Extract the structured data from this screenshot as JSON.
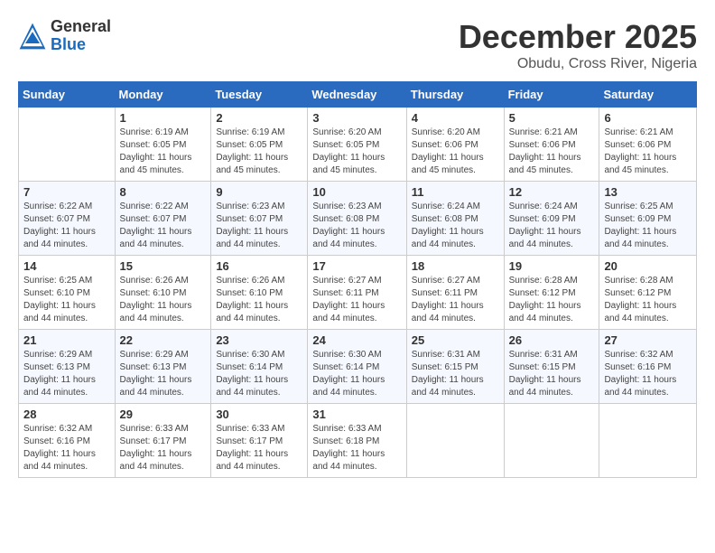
{
  "header": {
    "logo_general": "General",
    "logo_blue": "Blue",
    "month_title": "December 2025",
    "location": "Obudu, Cross River, Nigeria"
  },
  "calendar": {
    "weekdays": [
      "Sunday",
      "Monday",
      "Tuesday",
      "Wednesday",
      "Thursday",
      "Friday",
      "Saturday"
    ],
    "rows": [
      [
        {
          "day": "",
          "info": ""
        },
        {
          "day": "1",
          "info": "Sunrise: 6:19 AM\nSunset: 6:05 PM\nDaylight: 11 hours\nand 45 minutes."
        },
        {
          "day": "2",
          "info": "Sunrise: 6:19 AM\nSunset: 6:05 PM\nDaylight: 11 hours\nand 45 minutes."
        },
        {
          "day": "3",
          "info": "Sunrise: 6:20 AM\nSunset: 6:05 PM\nDaylight: 11 hours\nand 45 minutes."
        },
        {
          "day": "4",
          "info": "Sunrise: 6:20 AM\nSunset: 6:06 PM\nDaylight: 11 hours\nand 45 minutes."
        },
        {
          "day": "5",
          "info": "Sunrise: 6:21 AM\nSunset: 6:06 PM\nDaylight: 11 hours\nand 45 minutes."
        },
        {
          "day": "6",
          "info": "Sunrise: 6:21 AM\nSunset: 6:06 PM\nDaylight: 11 hours\nand 45 minutes."
        }
      ],
      [
        {
          "day": "7",
          "info": "Sunrise: 6:22 AM\nSunset: 6:07 PM\nDaylight: 11 hours\nand 44 minutes."
        },
        {
          "day": "8",
          "info": "Sunrise: 6:22 AM\nSunset: 6:07 PM\nDaylight: 11 hours\nand 44 minutes."
        },
        {
          "day": "9",
          "info": "Sunrise: 6:23 AM\nSunset: 6:07 PM\nDaylight: 11 hours\nand 44 minutes."
        },
        {
          "day": "10",
          "info": "Sunrise: 6:23 AM\nSunset: 6:08 PM\nDaylight: 11 hours\nand 44 minutes."
        },
        {
          "day": "11",
          "info": "Sunrise: 6:24 AM\nSunset: 6:08 PM\nDaylight: 11 hours\nand 44 minutes."
        },
        {
          "day": "12",
          "info": "Sunrise: 6:24 AM\nSunset: 6:09 PM\nDaylight: 11 hours\nand 44 minutes."
        },
        {
          "day": "13",
          "info": "Sunrise: 6:25 AM\nSunset: 6:09 PM\nDaylight: 11 hours\nand 44 minutes."
        }
      ],
      [
        {
          "day": "14",
          "info": "Sunrise: 6:25 AM\nSunset: 6:10 PM\nDaylight: 11 hours\nand 44 minutes."
        },
        {
          "day": "15",
          "info": "Sunrise: 6:26 AM\nSunset: 6:10 PM\nDaylight: 11 hours\nand 44 minutes."
        },
        {
          "day": "16",
          "info": "Sunrise: 6:26 AM\nSunset: 6:10 PM\nDaylight: 11 hours\nand 44 minutes."
        },
        {
          "day": "17",
          "info": "Sunrise: 6:27 AM\nSunset: 6:11 PM\nDaylight: 11 hours\nand 44 minutes."
        },
        {
          "day": "18",
          "info": "Sunrise: 6:27 AM\nSunset: 6:11 PM\nDaylight: 11 hours\nand 44 minutes."
        },
        {
          "day": "19",
          "info": "Sunrise: 6:28 AM\nSunset: 6:12 PM\nDaylight: 11 hours\nand 44 minutes."
        },
        {
          "day": "20",
          "info": "Sunrise: 6:28 AM\nSunset: 6:12 PM\nDaylight: 11 hours\nand 44 minutes."
        }
      ],
      [
        {
          "day": "21",
          "info": "Sunrise: 6:29 AM\nSunset: 6:13 PM\nDaylight: 11 hours\nand 44 minutes."
        },
        {
          "day": "22",
          "info": "Sunrise: 6:29 AM\nSunset: 6:13 PM\nDaylight: 11 hours\nand 44 minutes."
        },
        {
          "day": "23",
          "info": "Sunrise: 6:30 AM\nSunset: 6:14 PM\nDaylight: 11 hours\nand 44 minutes."
        },
        {
          "day": "24",
          "info": "Sunrise: 6:30 AM\nSunset: 6:14 PM\nDaylight: 11 hours\nand 44 minutes."
        },
        {
          "day": "25",
          "info": "Sunrise: 6:31 AM\nSunset: 6:15 PM\nDaylight: 11 hours\nand 44 minutes."
        },
        {
          "day": "26",
          "info": "Sunrise: 6:31 AM\nSunset: 6:15 PM\nDaylight: 11 hours\nand 44 minutes."
        },
        {
          "day": "27",
          "info": "Sunrise: 6:32 AM\nSunset: 6:16 PM\nDaylight: 11 hours\nand 44 minutes."
        }
      ],
      [
        {
          "day": "28",
          "info": "Sunrise: 6:32 AM\nSunset: 6:16 PM\nDaylight: 11 hours\nand 44 minutes."
        },
        {
          "day": "29",
          "info": "Sunrise: 6:33 AM\nSunset: 6:17 PM\nDaylight: 11 hours\nand 44 minutes."
        },
        {
          "day": "30",
          "info": "Sunrise: 6:33 AM\nSunset: 6:17 PM\nDaylight: 11 hours\nand 44 minutes."
        },
        {
          "day": "31",
          "info": "Sunrise: 6:33 AM\nSunset: 6:18 PM\nDaylight: 11 hours\nand 44 minutes."
        },
        {
          "day": "",
          "info": ""
        },
        {
          "day": "",
          "info": ""
        },
        {
          "day": "",
          "info": ""
        }
      ]
    ]
  }
}
